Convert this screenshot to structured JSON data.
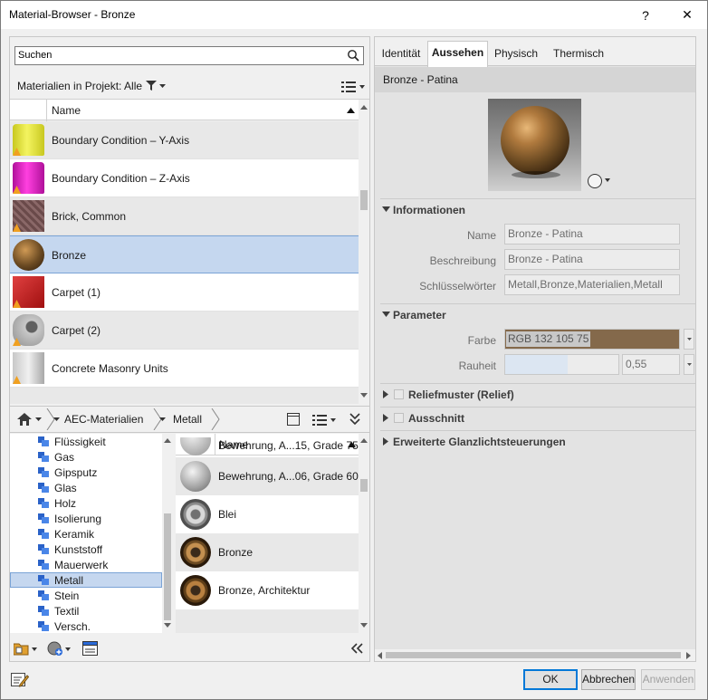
{
  "window": {
    "title": "Material-Browser - Bronze",
    "help_label": "?",
    "close_label": "✕"
  },
  "search": {
    "value": "Suchen"
  },
  "project": {
    "filter_label": "Materialien in Projekt: Alle"
  },
  "material_list": {
    "column_header": "Name",
    "items": [
      {
        "label": "Boundary Condition – Y-Axis",
        "color": "#e8e83a"
      },
      {
        "label": "Boundary Condition – Z-Axis",
        "color": "#e020c8"
      },
      {
        "label": "Brick, Common",
        "color": "#7a5a5a"
      },
      {
        "label": "Bronze",
        "color": "#6b4a22"
      },
      {
        "label": "Carpet (1)",
        "color": "#c02020"
      },
      {
        "label": "Carpet (2)",
        "color": "#a0a0a0"
      },
      {
        "label": "Concrete Masonry Units",
        "color": "#b0b0b0"
      }
    ]
  },
  "library": {
    "breadcrumbs": [
      "AEC-Materialien",
      "Metall"
    ],
    "categories": [
      "Flüssigkeit",
      "Gas",
      "Gipsputz",
      "Glas",
      "Holz",
      "Isolierung",
      "Keramik",
      "Kunststoff",
      "Mauerwerk",
      "Metall",
      "Stein",
      "Textil",
      "Versch."
    ],
    "selected_category": "Metall",
    "column_header": "Name",
    "items": [
      {
        "label": "Bewehrung, A...15, Grade 75"
      },
      {
        "label": "Bewehrung, A...06, Grade 60"
      },
      {
        "label": "Blei"
      },
      {
        "label": "Bronze"
      },
      {
        "label": "Bronze, Architektur"
      }
    ]
  },
  "tabs": [
    "Identität",
    "Aussehen",
    "Physisch",
    "Thermisch"
  ],
  "active_tab": "Aussehen",
  "asset": {
    "name": "Bronze - Patina"
  },
  "information": {
    "title": "Informationen",
    "name_label": "Name",
    "name_value": "Bronze - Patina",
    "desc_label": "Beschreibung",
    "desc_value": "Bronze - Patina",
    "keywords_label": "Schlüsselwörter",
    "keywords_value": "Metall,Bronze,Materialien,Metall"
  },
  "parameters": {
    "title": "Parameter",
    "color_label": "Farbe",
    "color_value": "RGB 132 105 75",
    "color_hex": "#84694b",
    "roughness_label": "Rauheit",
    "roughness_value": "0,55"
  },
  "sections": {
    "relief": "Reliefmuster (Relief)",
    "cutout": "Ausschnitt",
    "highlights": "Erweiterte Glanzlichtsteuerungen"
  },
  "buttons": {
    "ok": "OK",
    "cancel": "Abbrechen",
    "apply": "Anwenden"
  }
}
